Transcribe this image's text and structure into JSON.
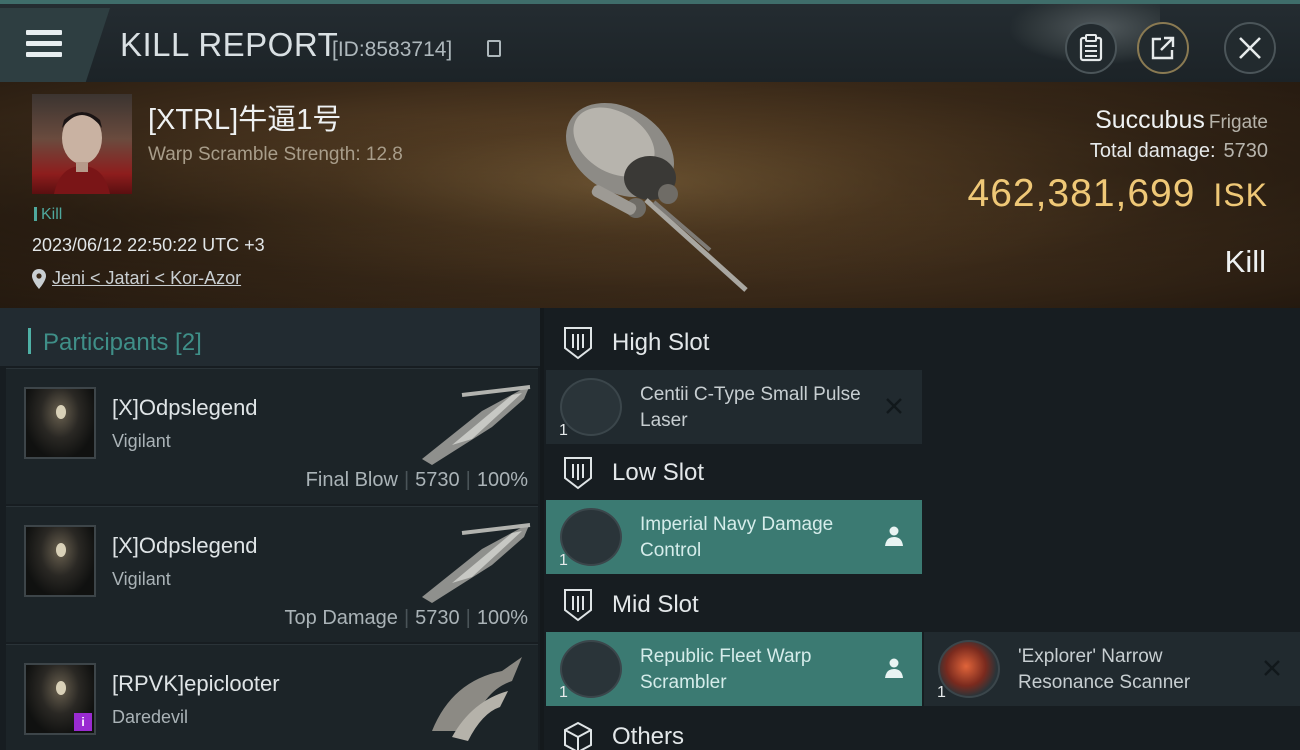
{
  "header": {
    "title": "KILL REPORT",
    "report_id": "[ID:8583714]"
  },
  "victim": {
    "name": "[XTRL]牛逼1号",
    "warp_scramble": "Warp Scramble Strength: 12.8",
    "tag": "Kill",
    "datetime": "2023/06/12 22:50:22 UTC +3",
    "location": "Jeni < Jatari < Kor-Azor",
    "ship_name": "Succubus",
    "ship_class": "Frigate",
    "total_damage_label": "Total damage:",
    "total_damage": "5730",
    "isk_value": "462,381,699",
    "isk_unit": "ISK",
    "result": "Kill"
  },
  "participants": {
    "header": "Participants [2]",
    "rows": [
      {
        "name": "[X]Odpslegend",
        "ship": "Vigilant",
        "role": "Final Blow",
        "damage": "5730",
        "percent": "100%"
      },
      {
        "name": "[X]Odpslegend",
        "ship": "Vigilant",
        "role": "Top Damage",
        "damage": "5730",
        "percent": "100%"
      },
      {
        "name": "[RPVK]epiclooter",
        "ship": "Daredevil",
        "badge": "i"
      }
    ]
  },
  "fitting": {
    "high_slot": "High Slot",
    "low_slot": "Low Slot",
    "mid_slot": "Mid Slot",
    "others": "Others",
    "items": {
      "high_1": {
        "name": "Centii C-Type Small Pulse Laser",
        "qty": "1",
        "status": "destroyed"
      },
      "low_1": {
        "name": "Imperial Navy Damage Control",
        "qty": "1",
        "status": "dropped"
      },
      "mid_1": {
        "name": "Republic Fleet Warp Scrambler",
        "qty": "1",
        "status": "dropped"
      },
      "mid_2": {
        "name": "'Explorer' Narrow Resonance Scanner",
        "qty": "1",
        "status": "destroyed"
      }
    }
  },
  "colors": {
    "accent": "#4fb1a6",
    "isk_gold": "#efc877",
    "dropped_bg": "#3b7a72"
  }
}
